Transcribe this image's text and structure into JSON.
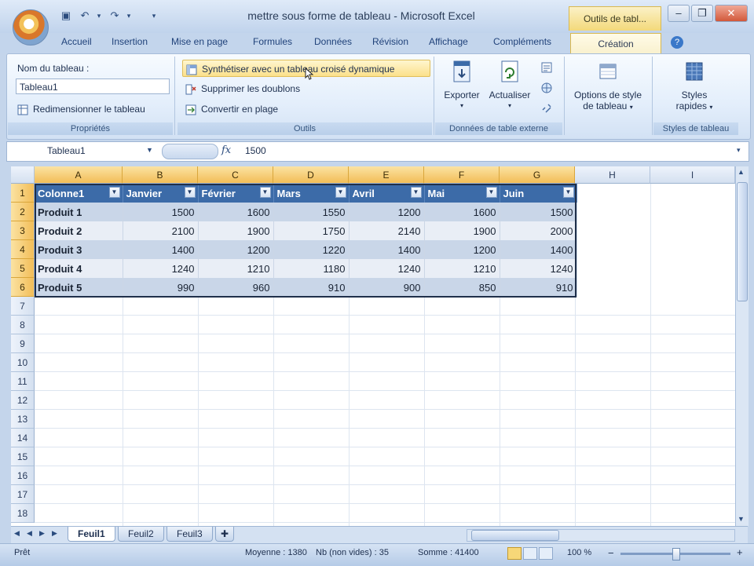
{
  "title": "mettre sous forme de tableau - Microsoft Excel",
  "contextual_tab_group": "Outils de tabl...",
  "window_buttons": {
    "minimize": "–",
    "restore": "❐",
    "close": "✕"
  },
  "ribbon_tabs": [
    "Accueil",
    "Insertion",
    "Mise en page",
    "Formules",
    "Données",
    "Révision",
    "Affichage",
    "Compléments",
    "Création"
  ],
  "ribbon": {
    "properties": {
      "table_name_label": "Nom du tableau :",
      "table_name_value": "Tableau1",
      "resize_label": "Redimensionner le tableau",
      "group_label": "Propriétés"
    },
    "tools": {
      "summarize_label": "Synthétiser avec un tableau croisé dynamique",
      "remove_duplicates_label": "Supprimer les doublons",
      "convert_label": "Convertir en plage",
      "group_label": "Outils"
    },
    "external_data": {
      "export_label": "Exporter",
      "refresh_label": "Actualiser",
      "group_label": "Données de table externe"
    },
    "style_options": {
      "label_line1": "Options de style",
      "label_line2": "de tableau"
    },
    "table_styles": {
      "label_line1": "Styles",
      "label_line2": "rapides",
      "group_label": "Styles de tableau"
    }
  },
  "formula_bar": {
    "name_box": "Tableau1",
    "fx": "fx",
    "value": "1500"
  },
  "columns": [
    "A",
    "B",
    "C",
    "D",
    "E",
    "F",
    "G",
    "H",
    "I"
  ],
  "rows": [
    "1",
    "2",
    "3",
    "4",
    "5",
    "6",
    "7",
    "8",
    "9",
    "10",
    "11",
    "12",
    "13",
    "14",
    "15",
    "16",
    "17",
    "18"
  ],
  "table": {
    "headers": [
      "Colonne1",
      "Janvier",
      "Février",
      "Mars",
      "Avril",
      "Mai",
      "Juin"
    ],
    "rows": [
      [
        "Produit 1",
        "1500",
        "1600",
        "1550",
        "1200",
        "1600",
        "1500"
      ],
      [
        "Produit 2",
        "2100",
        "1900",
        "1750",
        "2140",
        "1900",
        "2000"
      ],
      [
        "Produit 3",
        "1400",
        "1200",
        "1220",
        "1400",
        "1200",
        "1400"
      ],
      [
        "Produit 4",
        "1240",
        "1210",
        "1180",
        "1240",
        "1210",
        "1240"
      ],
      [
        "Produit 5",
        "990",
        "960",
        "910",
        "900",
        "850",
        "910"
      ]
    ]
  },
  "sheets": [
    "Feuil1",
    "Feuil2",
    "Feuil3"
  ],
  "status_bar": {
    "mode": "Prêt",
    "average": "Moyenne : 1380",
    "count": "Nb (non vides) : 35",
    "sum": "Somme : 41400",
    "zoom": "100 %"
  },
  "colors": {
    "table_header": "#3c6ba8",
    "band_dark": "#c9d6e8",
    "band_light": "#e9eef6",
    "selected_header": "#f2bd57"
  }
}
